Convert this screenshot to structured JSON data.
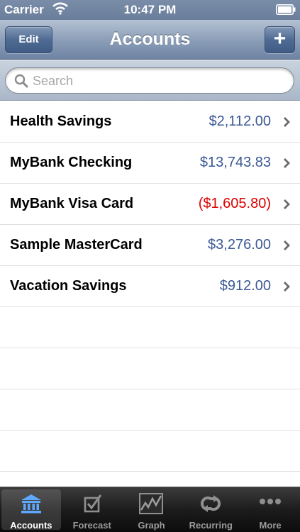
{
  "status_bar": {
    "carrier": "Carrier",
    "time": "10:47 PM"
  },
  "nav": {
    "title": "Accounts",
    "edit_label": "Edit",
    "add_label": "+"
  },
  "search": {
    "placeholder": "Search",
    "value": ""
  },
  "accounts": [
    {
      "name": "Health Savings",
      "amount": "$2,112.00",
      "negative": false
    },
    {
      "name": "MyBank Checking",
      "amount": "$13,743.83",
      "negative": false
    },
    {
      "name": "MyBank Visa Card",
      "amount": "($1,605.80)",
      "negative": true
    },
    {
      "name": "Sample MasterCard",
      "amount": "$3,276.00",
      "negative": false
    },
    {
      "name": "Vacation Savings",
      "amount": "$912.00",
      "negative": false
    }
  ],
  "tabs": [
    {
      "label": "Accounts",
      "icon": "bank-icon",
      "active": true
    },
    {
      "label": "Forecast",
      "icon": "checkbox-icon",
      "active": false
    },
    {
      "label": "Graph",
      "icon": "graph-icon",
      "active": false
    },
    {
      "label": "Recurring",
      "icon": "repeat-icon",
      "active": false
    },
    {
      "label": "More",
      "icon": "more-dots-icon",
      "active": false
    }
  ],
  "colors": {
    "amount_positive": "#3b5896",
    "amount_negative": "#dd0000",
    "nav_bar": "#6e84a4"
  }
}
